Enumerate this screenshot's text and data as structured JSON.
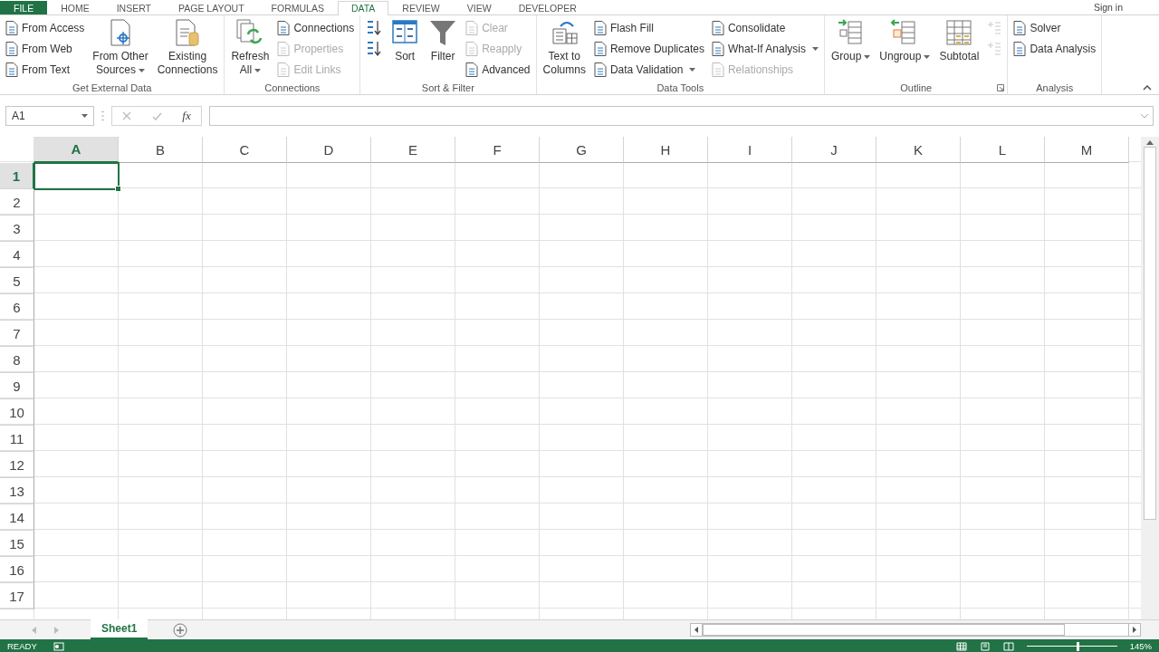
{
  "tabs": [
    {
      "label": "FILE",
      "kind": "file",
      "selected": false
    },
    {
      "label": "HOME",
      "kind": "tab",
      "selected": false
    },
    {
      "label": "INSERT",
      "kind": "tab",
      "selected": false
    },
    {
      "label": "PAGE LAYOUT",
      "kind": "tab",
      "selected": false
    },
    {
      "label": "FORMULAS",
      "kind": "tab",
      "selected": false
    },
    {
      "label": "DATA",
      "kind": "tab",
      "selected": true
    },
    {
      "label": "REVIEW",
      "kind": "tab",
      "selected": false
    },
    {
      "label": "VIEW",
      "kind": "tab",
      "selected": false
    },
    {
      "label": "DEVELOPER",
      "kind": "tab",
      "selected": false
    }
  ],
  "account": {
    "label": "Sign in"
  },
  "ribbon_groups": [
    {
      "label": "Get External Data",
      "columns": [
        {
          "kind": "stack",
          "items": [
            {
              "kind": "text",
              "label": "From Access",
              "disabled": false
            },
            {
              "kind": "text",
              "label": "From Web",
              "disabled": false
            },
            {
              "kind": "text",
              "label": "From Text",
              "disabled": false
            }
          ]
        },
        {
          "kind": "large",
          "lines": [
            "From Other",
            "Sources"
          ],
          "disabled": false,
          "dropdown": true
        },
        {
          "kind": "large",
          "lines": [
            "Existing",
            "Connections"
          ],
          "disabled": false
        }
      ]
    },
    {
      "label": "Connections",
      "columns": [
        {
          "kind": "large",
          "lines": [
            "Refresh",
            "All"
          ],
          "disabled": false,
          "dropdown": true
        },
        {
          "kind": "stack",
          "items": [
            {
              "kind": "text",
              "label": "Connections",
              "disabled": false
            },
            {
              "kind": "text",
              "label": "Properties",
              "disabled": true
            },
            {
              "kind": "text",
              "label": "Edit Links",
              "disabled": true
            }
          ]
        }
      ]
    },
    {
      "label": "Sort & Filter",
      "columns": [
        {
          "kind": "stack",
          "items": [
            {
              "kind": "sort",
              "disabled": false
            },
            {
              "kind": "sort",
              "disabled": false
            }
          ]
        },
        {
          "kind": "large",
          "lines": [
            "Sort"
          ],
          "disabled": false
        },
        {
          "kind": "large",
          "lines": [
            "Filter"
          ],
          "disabled": false
        },
        {
          "kind": "stack",
          "items": [
            {
              "kind": "text",
              "label": "Clear",
              "disabled": true
            },
            {
              "kind": "text",
              "label": "Reapply",
              "disabled": true
            },
            {
              "kind": "text",
              "label": "Advanced",
              "disabled": false
            }
          ]
        }
      ]
    },
    {
      "label": "Data Tools",
      "columns": [
        {
          "kind": "large",
          "lines": [
            "Text to",
            "Columns"
          ],
          "disabled": false
        },
        {
          "kind": "stack",
          "items": [
            {
              "kind": "text",
              "label": "Flash Fill",
              "disabled": false
            },
            {
              "kind": "text",
              "label": "Remove Duplicates",
              "disabled": false
            },
            {
              "kind": "text",
              "label": "Data Validation",
              "disabled": false,
              "dropdown": true
            }
          ]
        },
        {
          "kind": "stack",
          "items": [
            {
              "kind": "text",
              "label": "Consolidate",
              "disabled": false
            },
            {
              "kind": "text",
              "label": "What-If Analysis",
              "disabled": false,
              "dropdown": true
            },
            {
              "kind": "text",
              "label": "Relationships",
              "disabled": true
            }
          ]
        }
      ]
    },
    {
      "label": "Outline",
      "launcher": true,
      "columns": [
        {
          "kind": "large",
          "lines": [
            "Group"
          ],
          "disabled": false,
          "dropdown": true
        },
        {
          "kind": "large",
          "lines": [
            "Ungroup"
          ],
          "disabled": false,
          "dropdown": true
        },
        {
          "kind": "large",
          "lines": [
            "Subtotal"
          ],
          "disabled": false
        },
        {
          "kind": "stack",
          "items": [
            {
              "kind": "outline",
              "disabled": true
            },
            {
              "kind": "outline",
              "disabled": true
            }
          ]
        }
      ]
    },
    {
      "label": "Analysis",
      "columns": [
        {
          "kind": "stack",
          "items": [
            {
              "kind": "text",
              "label": "Solver",
              "disabled": false
            },
            {
              "kind": "text",
              "label": "Data Analysis",
              "disabled": false
            }
          ]
        }
      ]
    }
  ],
  "name_box": {
    "value": "A1"
  },
  "formula_bar": {
    "function_label": "fx"
  },
  "columns": [
    {
      "label": "A",
      "selected": true
    },
    {
      "label": "B",
      "selected": false
    },
    {
      "label": "C",
      "selected": false
    },
    {
      "label": "D",
      "selected": false
    },
    {
      "label": "E",
      "selected": false
    },
    {
      "label": "F",
      "selected": false
    },
    {
      "label": "G",
      "selected": false
    },
    {
      "label": "H",
      "selected": false
    },
    {
      "label": "I",
      "selected": false
    },
    {
      "label": "J",
      "selected": false
    },
    {
      "label": "K",
      "selected": false
    },
    {
      "label": "L",
      "selected": false
    },
    {
      "label": "M",
      "selected": false
    }
  ],
  "rows": [
    {
      "label": "1",
      "selected": true
    },
    {
      "label": "2",
      "selected": false
    },
    {
      "label": "3",
      "selected": false
    },
    {
      "label": "4",
      "selected": false
    },
    {
      "label": "5",
      "selected": false
    },
    {
      "label": "6",
      "selected": false
    },
    {
      "label": "7",
      "selected": false
    },
    {
      "label": "8",
      "selected": false
    },
    {
      "label": "9",
      "selected": false
    },
    {
      "label": "10",
      "selected": false
    },
    {
      "label": "11",
      "selected": false
    },
    {
      "label": "12",
      "selected": false
    },
    {
      "label": "13",
      "selected": false
    },
    {
      "label": "14",
      "selected": false
    },
    {
      "label": "15",
      "selected": false
    },
    {
      "label": "16",
      "selected": false
    },
    {
      "label": "17",
      "selected": false
    }
  ],
  "sheet_tabs": [
    {
      "label": "Sheet1",
      "selected": true
    }
  ],
  "status_bar": {
    "mode": "READY",
    "zoom": "145%",
    "zoom_slider": {
      "level": 0.55
    }
  }
}
